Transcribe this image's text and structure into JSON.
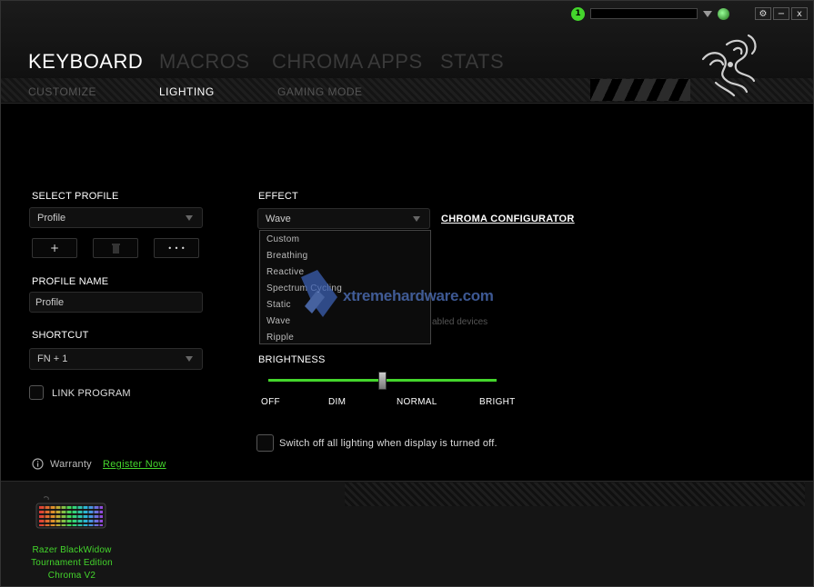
{
  "titlebar": {
    "notification_count": "1",
    "buttons": [
      "⚙",
      "−",
      "x"
    ]
  },
  "tabs": {
    "main": [
      "KEYBOARD",
      "MACROS",
      "CHROMA APPS",
      "STATS"
    ],
    "sub": [
      "CUSTOMIZE",
      "LIGHTING",
      "GAMING MODE"
    ]
  },
  "profile": {
    "select_label": "SELECT PROFILE",
    "selected": "Profile",
    "add_label": "+",
    "more_label": "• • •",
    "name_label": "PROFILE NAME",
    "name_value": "Profile"
  },
  "shortcut": {
    "label": "SHORTCUT",
    "value": "FN + 1"
  },
  "link_program": {
    "label": "LINK PROGRAM"
  },
  "warranty": {
    "label": "Warranty",
    "link": "Register Now"
  },
  "effect": {
    "label": "EFFECT",
    "selected": "Wave",
    "configurator_link": "CHROMA CONFIGURATOR",
    "options": [
      "Custom",
      "Breathing",
      "Reactive",
      "Spectrum Cycling",
      "Static",
      "Wave",
      "Ripple"
    ],
    "partial_text": "abled devices"
  },
  "brightness": {
    "label": "BRIGHTNESS",
    "value": 0.5,
    "ticks": [
      "OFF",
      "DIM",
      "NORMAL",
      "BRIGHT"
    ]
  },
  "display_off": {
    "label": "Switch off all lighting when display is turned off."
  },
  "watermark": {
    "text": "xtremehardware.com"
  },
  "device": {
    "name_lines": [
      "Razer BlackWidow",
      "Tournament Edition",
      "Chroma V2"
    ]
  },
  "colors": {
    "accent": "#44d62c",
    "background": "#000000"
  }
}
